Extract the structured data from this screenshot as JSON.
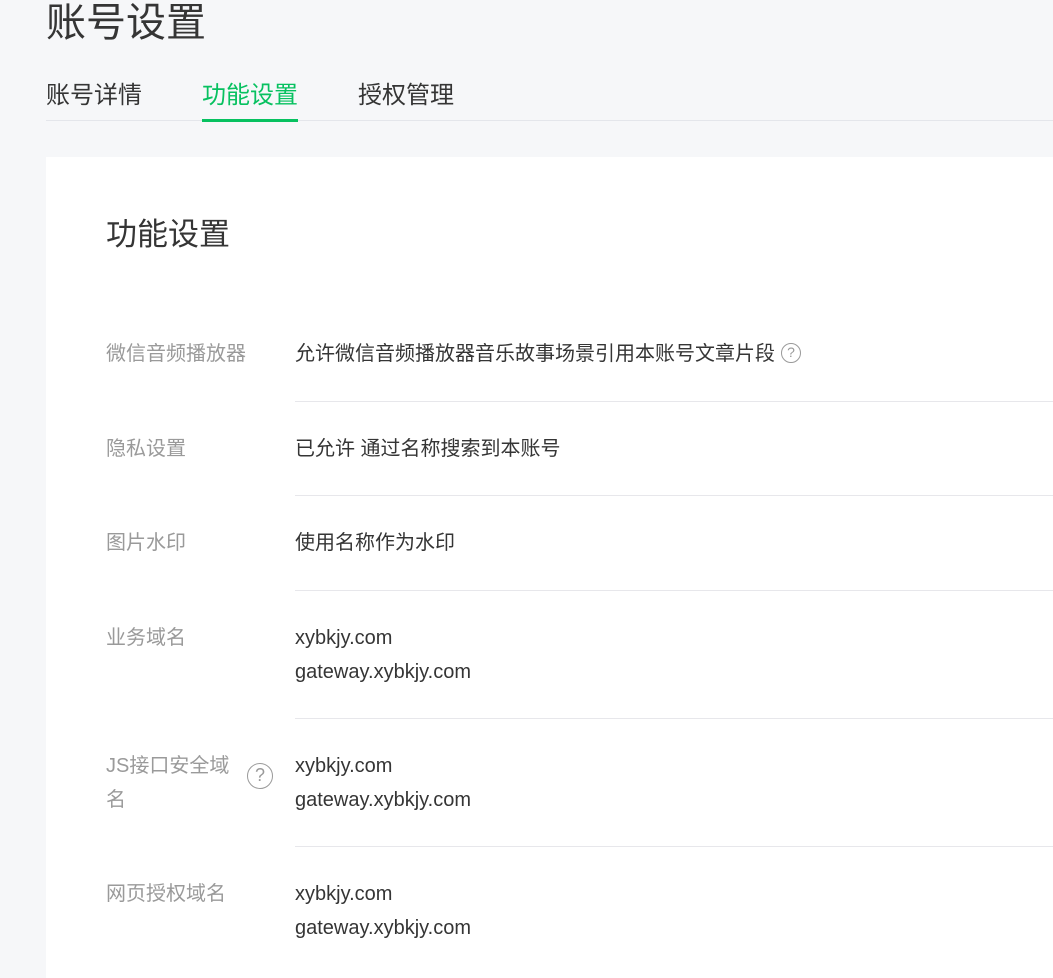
{
  "page": {
    "title": "账号设置"
  },
  "tabs": [
    {
      "label": "账号详情",
      "active": false
    },
    {
      "label": "功能设置",
      "active": true
    },
    {
      "label": "授权管理",
      "active": false
    }
  ],
  "card": {
    "title": "功能设置",
    "rows": [
      {
        "label": "微信音频播放器",
        "value": "允许微信音频播放器音乐故事场景引用本账号文章片段",
        "help": "?"
      },
      {
        "label": "隐私设置",
        "value": "已允许 通过名称搜索到本账号"
      },
      {
        "label": "图片水印",
        "value": "使用名称作为水印"
      },
      {
        "label": "业务域名",
        "values": [
          "xybkjy.com",
          "gateway.xybkjy.com"
        ]
      },
      {
        "label_line1": "JS接口安全域",
        "label_line2": "名",
        "help": "?",
        "values": [
          "xybkjy.com",
          "gateway.xybkjy.com"
        ]
      },
      {
        "label": "网页授权域名",
        "values": [
          "xybkjy.com",
          "gateway.xybkjy.com"
        ]
      }
    ]
  },
  "colors": {
    "accent": "#07c160",
    "label": "#9a9a9a",
    "text": "#353535"
  }
}
